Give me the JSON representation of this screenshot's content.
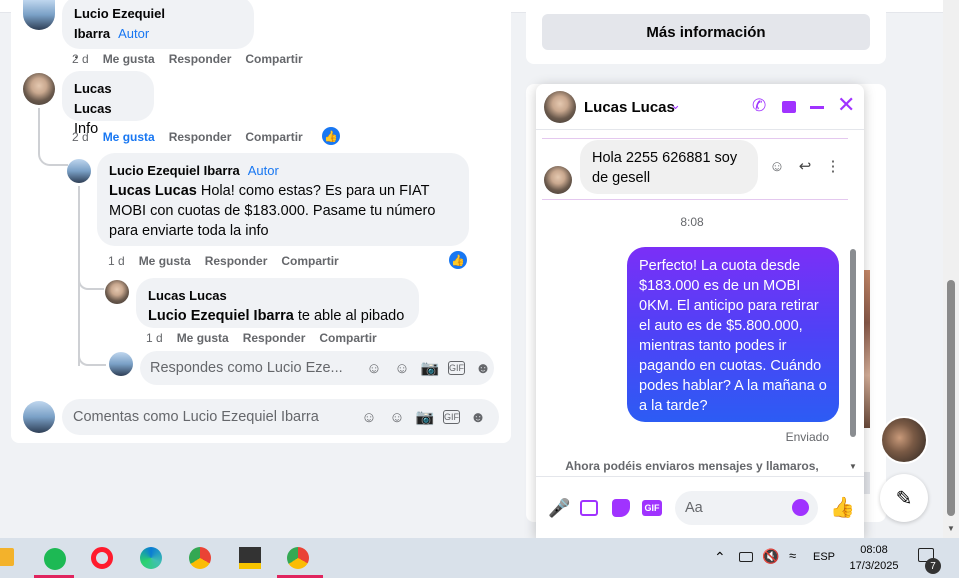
{
  "comments": {
    "top": {
      "author": "Lucio Ezequiel Ibarra",
      "role": "Autor",
      "text": ".",
      "time": "2 d",
      "like": "Me gusta",
      "reply": "Responder",
      "share": "Compartir"
    },
    "c1": {
      "author": "Lucas Lucas",
      "text": "Info",
      "time": "2 d",
      "like": "Me gusta",
      "reply": "Responder",
      "share": "Compartir"
    },
    "c2": {
      "author": "Lucio Ezequiel Ibarra",
      "role": "Autor",
      "mention": "Lucas Lucas",
      "text": "Hola! como estas? Es para un FIAT MOBI con cuotas de $183.000. Pasame tu número para enviarte toda la info",
      "time": "1 d",
      "like": "Me gusta",
      "reply": "Responder",
      "share": "Compartir"
    },
    "c3": {
      "author": "Lucas Lucas",
      "mention": "Lucio Ezequiel Ibarra",
      "text": "te able al pibado",
      "time": "1 d",
      "like": "Me gusta",
      "reply": "Responder",
      "share": "Compartir"
    },
    "reply_placeholder": "Respondes como Lucio Eze...",
    "comment_placeholder": "Comentas como Lucio Ezequiel Ibarra"
  },
  "side": {
    "more_info": "Más información"
  },
  "chat": {
    "contact": "Lucas Lucas",
    "incoming": "Hola 2255 626881 soy de gesell",
    "time": "8:08",
    "outgoing": "Perfecto! La cuota desde $183.000 es de un MOBI 0KM. El anticipo para retirar el auto es de $5.800.000, mientras tanto podes ir pagando en cuotas. Cuándo podes hablar? A la mañana o a la tarde?",
    "status": "Enviado",
    "notice": "Ahora podéis enviaros mensajes y llamaros,",
    "input_placeholder": "Aa",
    "accent": "#a033ff"
  },
  "taskbar": {
    "lang": "ESP",
    "time": "08:08",
    "date": "17/3/2025",
    "notif_count": "7"
  }
}
